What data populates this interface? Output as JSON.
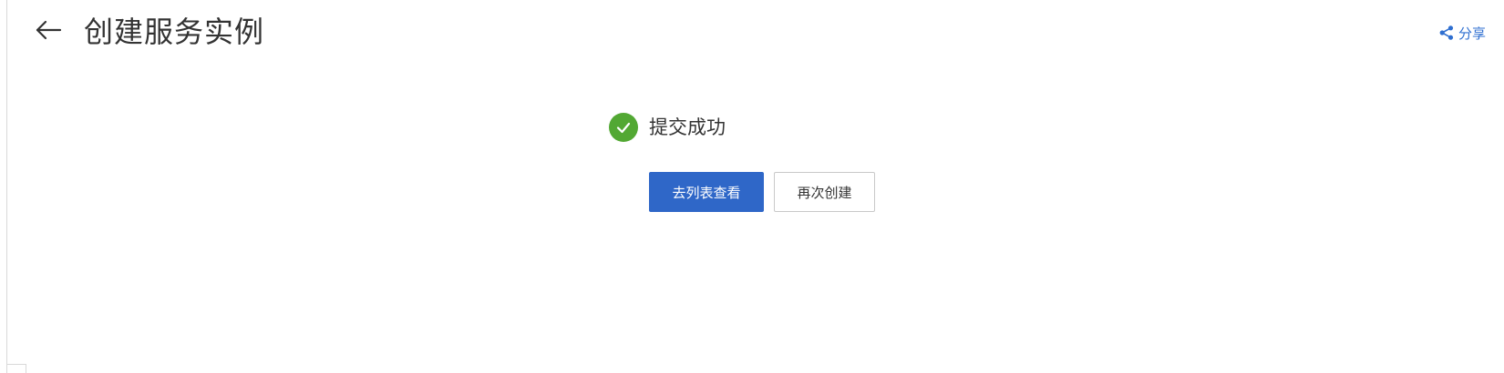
{
  "header": {
    "title": "创建服务实例",
    "back_icon": "arrow-left-icon",
    "share_label": "分享",
    "share_icon": "share-icon"
  },
  "result": {
    "status_icon": "check-circle-icon",
    "status_color": "#52a833",
    "message": "提交成功"
  },
  "actions": {
    "primary_label": "去列表查看",
    "secondary_label": "再次创建",
    "primary_color": "#2f67c8"
  }
}
